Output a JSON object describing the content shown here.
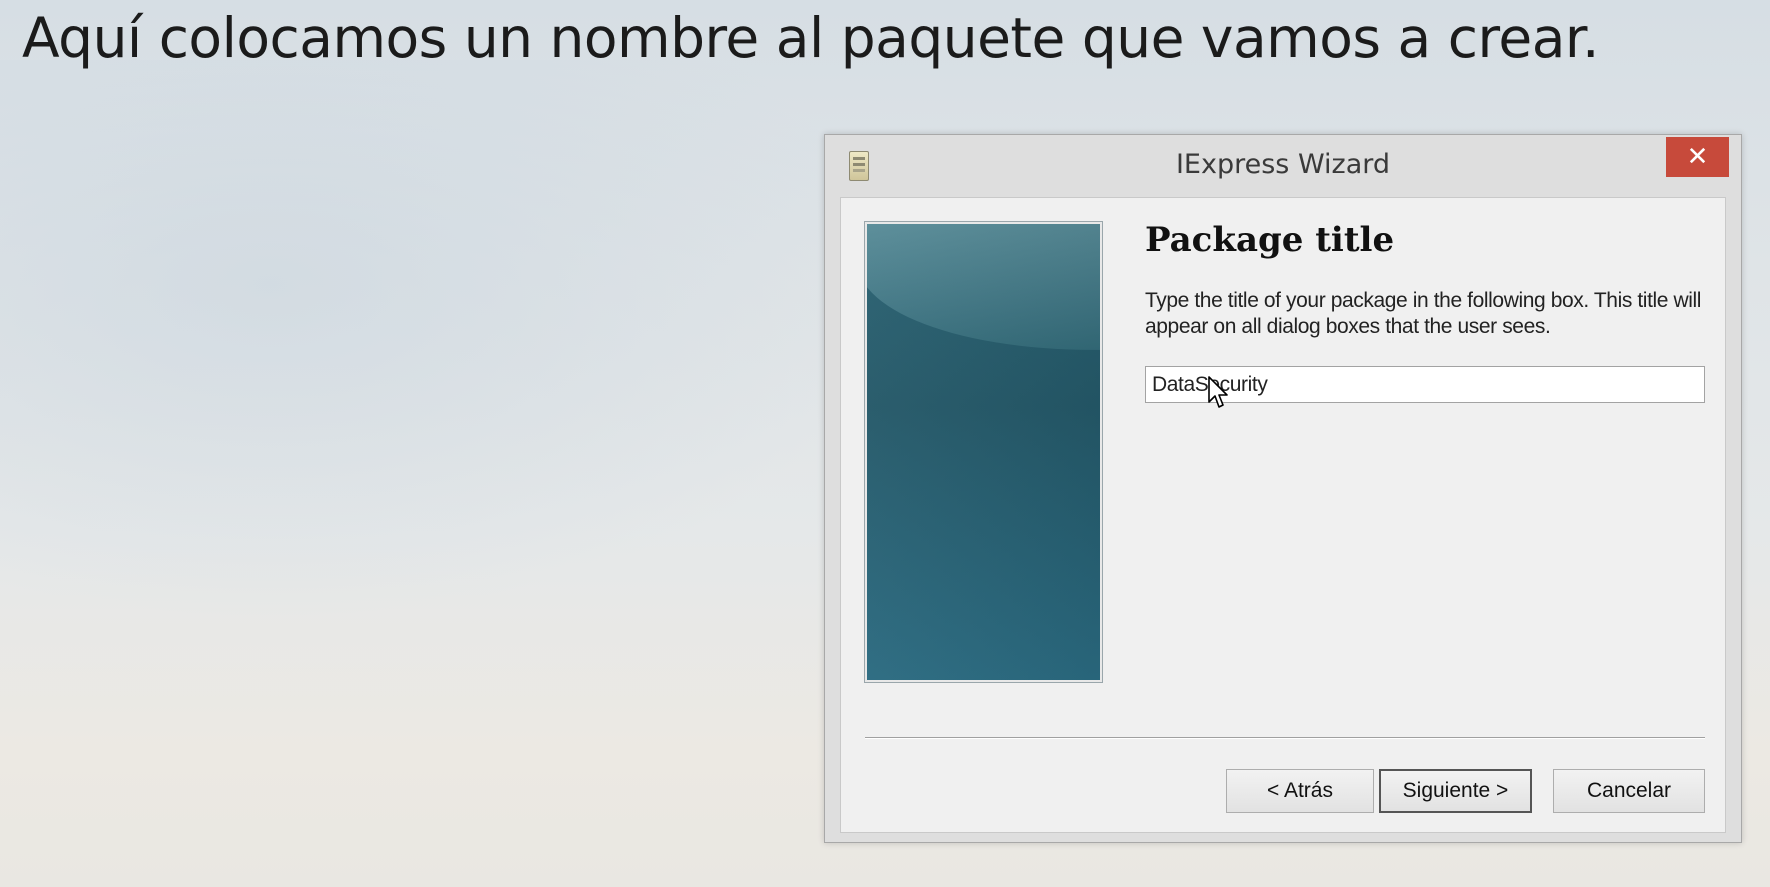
{
  "slide": {
    "heading": "Aquí colocamos un nombre al paquete que vamos a crear."
  },
  "window": {
    "title": "IExpress Wizard",
    "close_label": "✕",
    "app_icon": "document-icon"
  },
  "page": {
    "title": "Package title",
    "description": "Type the title of your package in the following  box.  This title will appear on all dialog boxes that the user sees.",
    "input_value": "DataSecurity"
  },
  "buttons": {
    "back": "< Atrás",
    "next": "Siguiente >",
    "cancel": "Cancelar"
  },
  "colors": {
    "close_button": "#c74a3b",
    "side_panel": "#245868"
  }
}
